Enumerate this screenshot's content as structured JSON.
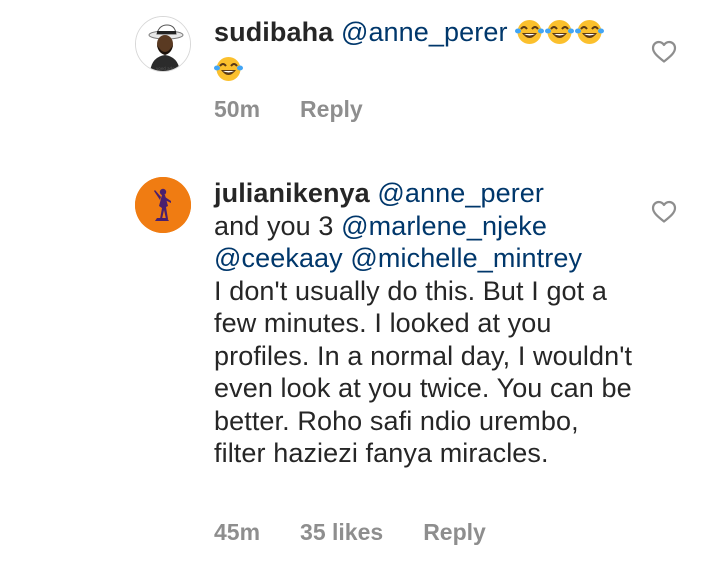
{
  "comments": [
    {
      "username": "sudibaha",
      "mentions": [
        "@anne_perer"
      ],
      "emoji_icons": [
        "laughing-emoji",
        "laughing-emoji",
        "laughing-emoji",
        "laughing-emoji"
      ],
      "time": "50m",
      "reply_label": "Reply",
      "avatar_icon": "person-avatar"
    },
    {
      "username": "julianikenya",
      "mentions": [
        "@anne_perer",
        "@marlene_njeke",
        "@ceekaay",
        "@michelle_mintrey"
      ],
      "text_prefix": "and you 3",
      "body": "I don't usually do this. But I got a few minutes. I looked at you profiles. In a normal day, I wouldn't even look at you twice. You can be better. Roho safi ndio urembo, filter haziezi fanya miracles.",
      "time": "45m",
      "likes": "35 likes",
      "reply_label": "Reply",
      "avatar_icon": "dancer-silhouette-avatar"
    }
  ],
  "colors": {
    "text": "#262626",
    "mention": "#00376b",
    "meta": "#8e8e8e",
    "avatar_orange": "#f07c12"
  },
  "icons": {
    "like": "heart-outline-icon"
  }
}
